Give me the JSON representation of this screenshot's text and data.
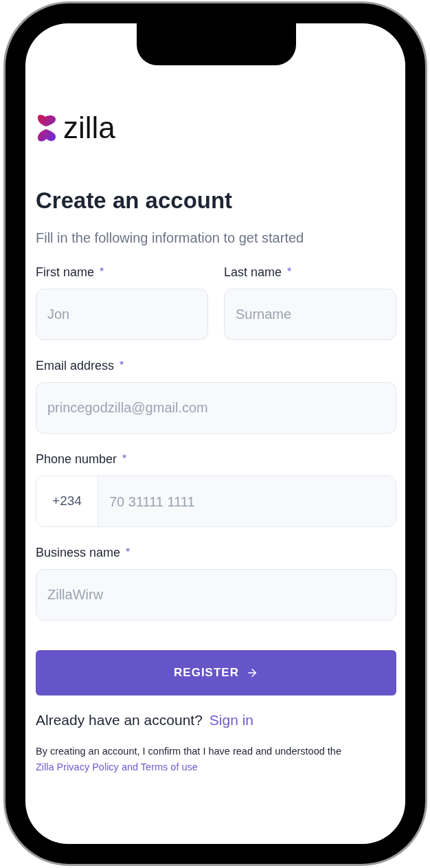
{
  "logo": {
    "text": "zilla"
  },
  "heading": "Create an account",
  "subtitle": "Fill in the following information to get started",
  "rows": [
    {
      "fields": [
        {
          "kind": "text",
          "label": "First name",
          "required_mark": "*",
          "placeholder": "Jon"
        },
        {
          "kind": "text",
          "label": "Last name",
          "required_mark": "*",
          "placeholder": "Surname"
        }
      ]
    },
    {
      "fields": [
        {
          "kind": "text",
          "label": "Email address",
          "required_mark": "*",
          "placeholder": "princegodzilla@gmail.com"
        }
      ]
    },
    {
      "fields": [
        {
          "kind": "phone",
          "label": "Phone number",
          "required_mark": "*",
          "prefix": "+234",
          "placeholder": "70 31111 1111"
        }
      ]
    },
    {
      "fields": [
        {
          "kind": "text",
          "label": "Business name",
          "required_mark": "*",
          "placeholder": "ZillaWirw"
        }
      ]
    }
  ],
  "register_button": {
    "label": "REGISTER"
  },
  "sign_in": {
    "prompt": "Already have an account?",
    "link": "Sign in"
  },
  "legal": {
    "text": "By creating an account, I confirm that I have read and understood the",
    "link": "Zilla Privacy Policy and Terms of use"
  }
}
